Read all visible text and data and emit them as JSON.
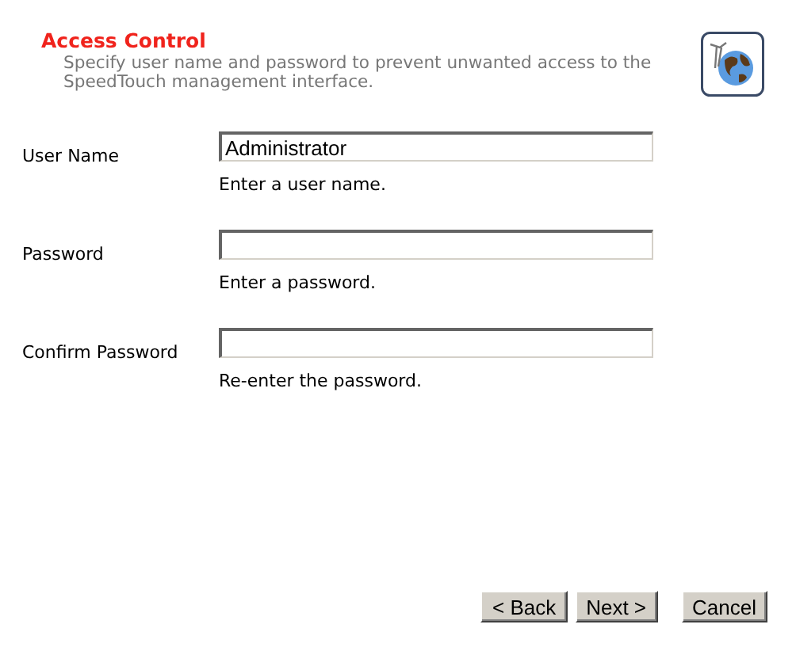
{
  "header": {
    "title": "Access Control",
    "description": "Specify user name and password to prevent unwanted access to the SpeedTouch management interface."
  },
  "fields": [
    {
      "label": "User Name",
      "value": "Administrator",
      "hint": "Enter a user name."
    },
    {
      "label": "Password",
      "hint": "Enter a password."
    },
    {
      "label": "Confirm Password",
      "hint": "Re-enter the password."
    }
  ],
  "buttons": [
    "< Back",
    "Next >",
    "Cancel"
  ]
}
